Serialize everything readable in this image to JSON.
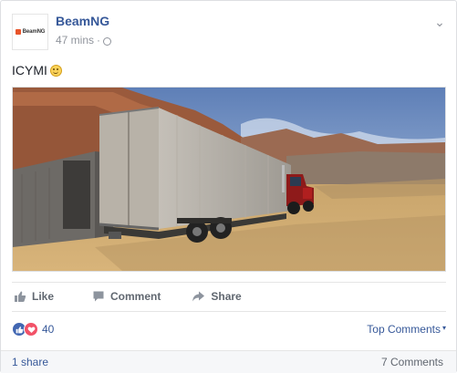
{
  "post": {
    "page_name": "BeamNG",
    "avatar_logo_text": "BeamNG",
    "timestamp": "47 mins",
    "separator": "·",
    "privacy_icon": "globe-icon",
    "text": "ICYMI",
    "emoji": "slightly-smiling-face-icon",
    "media_description_icon": "truck-trailer-image"
  },
  "actions": {
    "like_label": "Like",
    "comment_label": "Comment",
    "share_label": "Share"
  },
  "reactions": {
    "count": "40",
    "types": [
      "like-icon",
      "love-icon"
    ],
    "sort_label": "Top Comments"
  },
  "footer": {
    "shares": "1 share",
    "comments": "7 Comments"
  },
  "colors": {
    "link": "#365899",
    "muted": "#90949c",
    "like_blue": "#4267b2",
    "love_red": "#f25268",
    "brand_orange": "#e8542a"
  }
}
